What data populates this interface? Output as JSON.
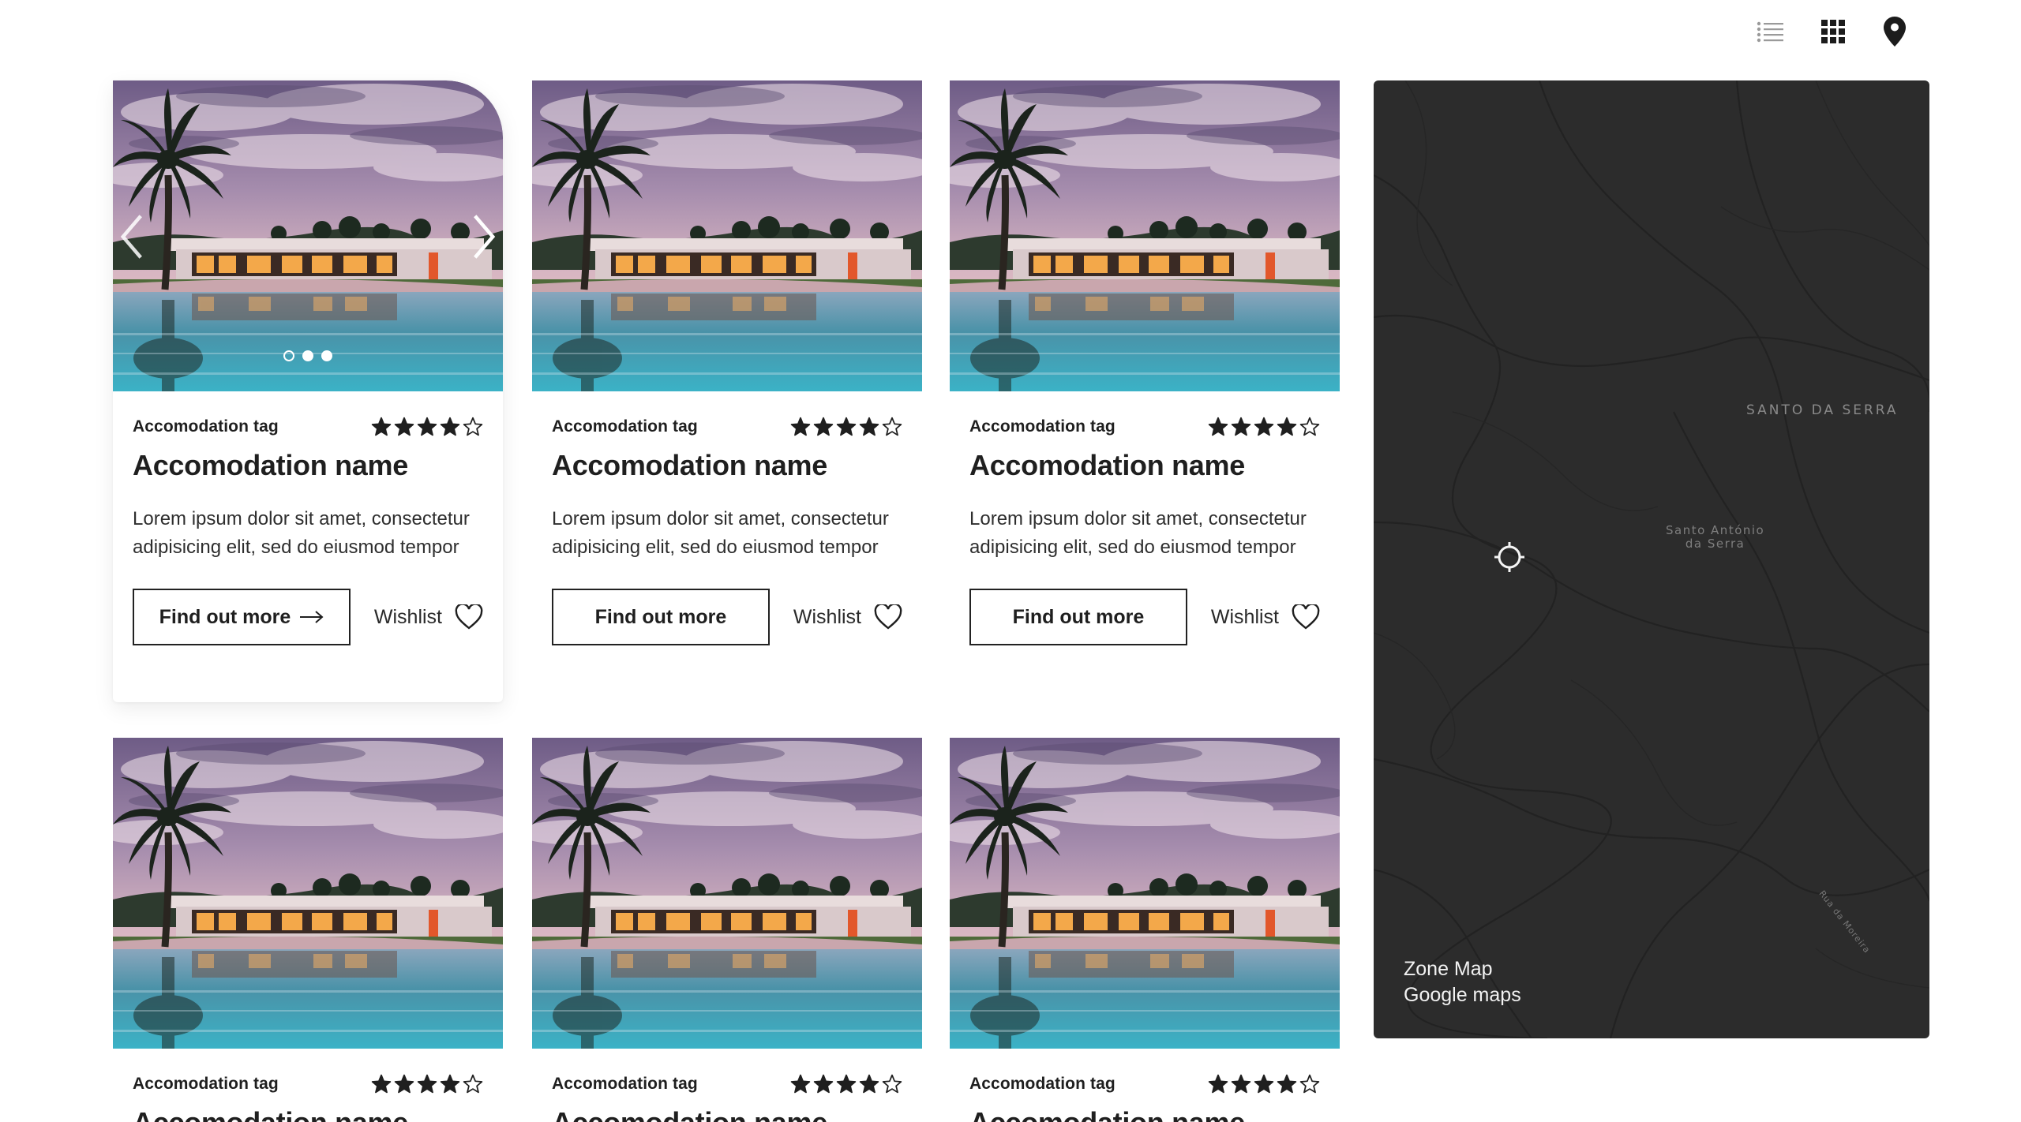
{
  "view_toggles": {
    "list_icon": "list-view-icon",
    "grid_icon": "grid-view-icon",
    "map_icon": "map-pin-icon"
  },
  "cards": [
    {
      "tag": "Accomodation tag",
      "name": "Accomodation name",
      "description": "Lorem ipsum dolor sit amet, consectetur adipisicing elit, sed do eiusmod tempor",
      "button": "Find out more",
      "wishlist": "Wishlist",
      "rating": 4,
      "rating_max": 5
    },
    {
      "tag": "Accomodation tag",
      "name": "Accomodation name",
      "description": "Lorem ipsum dolor sit amet, consectetur adipisicing elit, sed do eiusmod tempor",
      "button": "Find out more",
      "wishlist": "Wishlist",
      "rating": 4,
      "rating_max": 5
    },
    {
      "tag": "Accomodation tag",
      "name": "Accomodation name",
      "description": "Lorem ipsum dolor sit amet, consectetur adipisicing elit, sed do eiusmod tempor",
      "button": "Find out more",
      "wishlist": "Wishlist",
      "rating": 4,
      "rating_max": 5
    },
    {
      "tag": "Accomodation tag",
      "name": "Accomodation name",
      "rating": 4,
      "rating_max": 5
    },
    {
      "tag": "Accomodation tag",
      "name": "Accomodation name",
      "rating": 4,
      "rating_max": 5
    },
    {
      "tag": "Accomodation tag",
      "name": "Accomodation name",
      "rating": 4,
      "rating_max": 5
    }
  ],
  "carousel": {
    "slide_count": 3,
    "active_index": 0
  },
  "map": {
    "place_label": "SANTO DA SERRA",
    "place_small_line1": "Santo António",
    "place_small_line2": "da Serra",
    "road_label": "Rua da Moreira",
    "caption_line1": "Zone Map",
    "caption_line2": "Google maps"
  },
  "colors": {
    "text": "#1f1f1f",
    "map_bg": "#2c2c2c",
    "map_roads": "#222222"
  }
}
